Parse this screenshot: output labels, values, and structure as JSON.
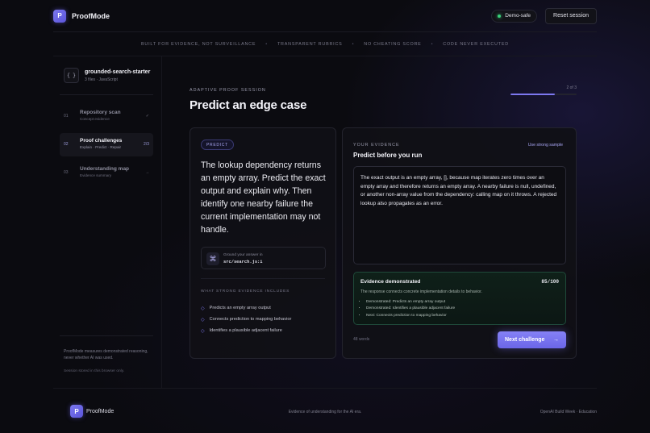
{
  "header": {
    "brand_initial": "P",
    "brand_name": "ProofMode",
    "status_pill": "Demo-safe",
    "reset_label": "Reset session",
    "status_color": "#3ad07a"
  },
  "strip": [
    "BUILT FOR EVIDENCE, NOT SURVEILLANCE",
    "TRANSPARENT RUBRICS",
    "NO CHEATING SCORE",
    "CODE NEVER EXECUTED"
  ],
  "sidebar": {
    "repo_icon": "{ }",
    "repo_name": "grounded-search-starter",
    "repo_meta": "3 files · JavaScript",
    "steps": [
      {
        "num": "01",
        "title": "Repository scan",
        "sub": "Concept evidence",
        "right": "✓"
      },
      {
        "num": "02",
        "title": "Proof challenges",
        "sub": "Explain · Predict · Repair",
        "right": "2/3"
      },
      {
        "num": "03",
        "title": "Understanding map",
        "sub": "Evidence summary",
        "right": "→"
      }
    ],
    "footer_note": "ProofMode measures demonstrated reasoning, never whether AI was used.",
    "session_note": "Session stored in this browser only."
  },
  "main": {
    "eyebrow": "ADAPTIVE PROOF SESSION",
    "title": "Predict an edge case",
    "progress_label": "2 of 3",
    "progress_fraction": 0.667,
    "accent": "#7d78f0"
  },
  "challenge": {
    "badge": "PREDICT",
    "prompt": "The lookup dependency returns an empty array. Predict the exact output and explain why. Then identify one nearby failure the current implementation may not handle.",
    "ground_icon": "⌘",
    "ground_label": "Ground your answer in",
    "ground_path": "src/search.js:1",
    "criteria_heading": "WHAT STRONG EVIDENCE INCLUDES",
    "criteria": [
      "Predicts an empty array output",
      "Connects prediction to mapping behavior",
      "Identifies a plausible adjacent failure"
    ]
  },
  "evidence_panel": {
    "label": "YOUR EVIDENCE",
    "title": "Predict before you run",
    "sample_link": "Use strong sample",
    "answer": "The exact output is an empty array, [], because map iterates zero times over an empty array and therefore returns an empty array. A nearby failure is null, undefined, or another non-array value from the dependency: calling map on it throws. A rejected lookup also propagates as an error.",
    "result": {
      "title": "Evidence demonstrated",
      "score": "85/100",
      "description": "The response connects concrete implementation details to behavior.",
      "items": [
        "Demonstrated: Predicts an empty array output",
        "Demonstrated: Identifies a plausible adjacent failure",
        "Next: Connects prediction to mapping behavior"
      ]
    },
    "word_count": "48 words",
    "next_label": "Next challenge",
    "next_arrow": "→"
  },
  "footer": {
    "brand_initial": "P",
    "brand_name": "ProofMode",
    "tagline": "Evidence of understanding for the AI era.",
    "credit": "OpenAI Build Week · Education"
  }
}
